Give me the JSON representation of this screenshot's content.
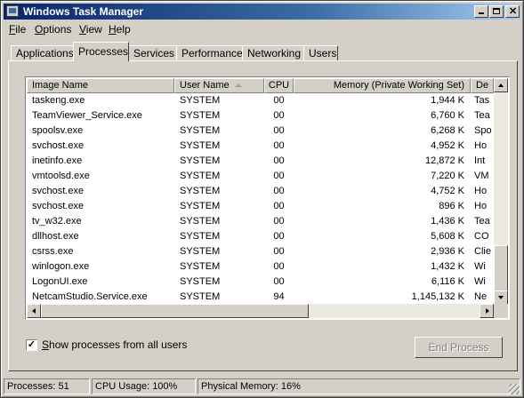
{
  "window": {
    "title": "Windows Task Manager"
  },
  "menu": [
    {
      "underline": "F",
      "rest": "ile"
    },
    {
      "underline": "O",
      "rest": "ptions"
    },
    {
      "underline": "V",
      "rest": "iew"
    },
    {
      "underline": "H",
      "rest": "elp"
    }
  ],
  "tabs": [
    "Applications",
    "Processes",
    "Services",
    "Performance",
    "Networking",
    "Users"
  ],
  "active_tab": "Processes",
  "columns": [
    "Image Name",
    "User Name",
    "CPU",
    "Memory (Private Working Set)",
    "De"
  ],
  "processes": [
    {
      "image": "taskeng.exe",
      "user": "SYSTEM",
      "cpu": "00",
      "memory": "1,944 K",
      "desc": "Tas"
    },
    {
      "image": "TeamViewer_Service.exe",
      "user": "SYSTEM",
      "cpu": "00",
      "memory": "6,760 K",
      "desc": "Tea"
    },
    {
      "image": "spoolsv.exe",
      "user": "SYSTEM",
      "cpu": "00",
      "memory": "6,268 K",
      "desc": "Spo"
    },
    {
      "image": "svchost.exe",
      "user": "SYSTEM",
      "cpu": "00",
      "memory": "4,952 K",
      "desc": "Ho"
    },
    {
      "image": "inetinfo.exe",
      "user": "SYSTEM",
      "cpu": "00",
      "memory": "12,872 K",
      "desc": "Int"
    },
    {
      "image": "vmtoolsd.exe",
      "user": "SYSTEM",
      "cpu": "00",
      "memory": "7,220 K",
      "desc": "VM"
    },
    {
      "image": "svchost.exe",
      "user": "SYSTEM",
      "cpu": "00",
      "memory": "4,752 K",
      "desc": "Ho"
    },
    {
      "image": "svchost.exe",
      "user": "SYSTEM",
      "cpu": "00",
      "memory": "896 K",
      "desc": "Ho"
    },
    {
      "image": "tv_w32.exe",
      "user": "SYSTEM",
      "cpu": "00",
      "memory": "1,436 K",
      "desc": "Tea"
    },
    {
      "image": "dllhost.exe",
      "user": "SYSTEM",
      "cpu": "00",
      "memory": "5,608 K",
      "desc": "CO"
    },
    {
      "image": "csrss.exe",
      "user": "SYSTEM",
      "cpu": "00",
      "memory": "2,936 K",
      "desc": "Clie"
    },
    {
      "image": "winlogon.exe",
      "user": "SYSTEM",
      "cpu": "00",
      "memory": "1,432 K",
      "desc": "Wi"
    },
    {
      "image": "LogonUI.exe",
      "user": "SYSTEM",
      "cpu": "00",
      "memory": "6,116 K",
      "desc": "Wi"
    },
    {
      "image": "NetcamStudio.Service.exe",
      "user": "SYSTEM",
      "cpu": "94",
      "memory": "1,145,132 K",
      "desc": "Ne"
    }
  ],
  "show_all_label": "Show processes from all users",
  "show_all_underline": "S",
  "show_all_rest": "how processes from all users",
  "show_all_checked": true,
  "end_process_label": "End Process",
  "status": {
    "processes": "Processes: 51",
    "cpu": "CPU Usage: 100%",
    "memory": "Physical Memory: 16%"
  }
}
